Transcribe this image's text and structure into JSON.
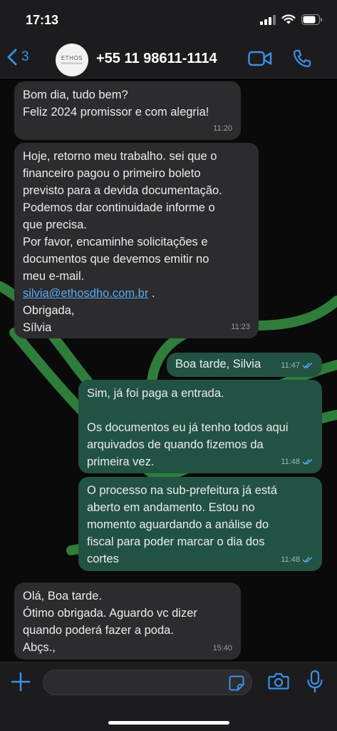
{
  "status": {
    "time": "17:13"
  },
  "header": {
    "back_count": "3",
    "contact_name": "+55 11 98611-1114",
    "avatar_brand": "ETHOS",
    "avatar_sub": "ENGENHARIA"
  },
  "colors": {
    "accent": "#3b8fe8",
    "incoming_bubble": "#2c2c2e",
    "outgoing_bubble": "#225244",
    "wallpaper_leaf": "#2f7d3b",
    "read_ticks": "#5aa8f0"
  },
  "messages": [
    {
      "direction": "in",
      "line1": "Bom dia, tudo bem?",
      "line2": "Feliz 2024 promissor e com alegria!",
      "time": "11:20"
    },
    {
      "direction": "in",
      "text_before_link": "Hoje, retorno meu trabalho.  sei que o\nfinanceiro pagou o primeiro boleto\nprevisto para a devida documentação.\nPodemos dar continuidade  informe o\nque precisa.\nPor favor, encaminhe solicitações e\ndocumentos que devemos emitir no\nmeu e-mail.",
      "link": "silvia@ethosdho.com.br",
      "link_suffix": " .",
      "text_after_link": "Obrigada,\nSílvia",
      "time": "11:23"
    },
    {
      "direction": "out",
      "text": "Boa tarde, Silvia",
      "time": "11:47"
    },
    {
      "direction": "out",
      "text": "Sim, já foi paga a entrada.\n\nOs documentos eu já tenho todos aqui\narquivados de quando fizemos da\nprimeira vez.",
      "time": "11:48"
    },
    {
      "direction": "out",
      "text": "O processo na sub-prefeitura já está\naberto em andamento. Estou no\nmomento aguardando a análise do\nfiscal para poder marcar o dia dos\ncortes",
      "time": "11:48"
    },
    {
      "direction": "in",
      "text": "Olá, Boa tarde.\nÓtimo obrigada. Aguardo vc dizer\nquando poderá fazer a poda.\nAbçs.,",
      "time": "15:40"
    }
  ],
  "icons": {
    "back": "chevron-left-icon",
    "video": "video-camera-icon",
    "call": "phone-icon",
    "plus": "plus-icon",
    "sticker": "sticker-icon",
    "camera": "camera-icon",
    "mic": "microphone-icon"
  }
}
